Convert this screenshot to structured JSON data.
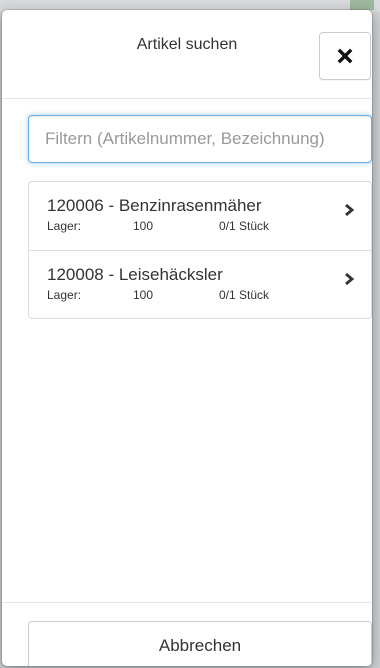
{
  "dialog": {
    "title": "Artikel suchen",
    "close_icon": "close-icon"
  },
  "filter": {
    "placeholder": "Filtern (Artikelnummer, Bezeichnung)",
    "value": ""
  },
  "articles": [
    {
      "title": "120006 - Benzinrasenmäher",
      "stock_label": "Lager:",
      "stock_value": "100",
      "quantity": "0/1 Stück",
      "icon": "chevron-right-icon"
    },
    {
      "title": "120008 - Leisehäcksler",
      "stock_label": "Lager:",
      "stock_value": "100",
      "quantity": "0/1 Stück",
      "icon": "chevron-right-icon"
    }
  ],
  "footer": {
    "cancel_label": "Abbrechen"
  },
  "colors": {
    "focus_border": "#66afe9",
    "text": "#333333",
    "border": "#dddddd"
  }
}
